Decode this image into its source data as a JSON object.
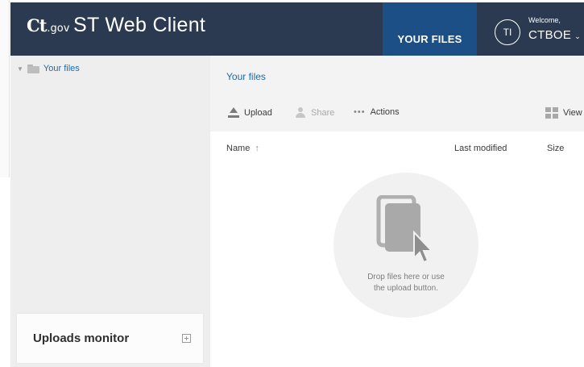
{
  "header": {
    "logo_ct": "Ct",
    "logo_gov": ".gov",
    "app_title": "ST Web Client",
    "nav_tab": "YOUR FILES",
    "avatar_initials": "TI",
    "welcome": "Welcome,",
    "user_name": "CTBOE",
    "user_caret": "⌄",
    "bg_color": "#2b3a50",
    "active_tab_color": "#1b4f86"
  },
  "sidebar": {
    "tree_item": "Your files",
    "tree_arrow": "▼",
    "uploads_monitor": "Uploads monitor"
  },
  "main": {
    "breadcrumb": "Your files",
    "toolbar": {
      "upload": "Upload",
      "share": "Share",
      "actions_dots": "•••",
      "actions": "Actions",
      "view": "View"
    },
    "columns": {
      "name": "Name",
      "name_sort": "↑",
      "last_modified": "Last modified",
      "size": "Size"
    },
    "drop_zone": {
      "line1": "Drop files here or use",
      "line2": "the upload button."
    },
    "link_color": "#1c6aa8"
  },
  "icons": [
    "folder-icon",
    "upload-icon",
    "share-icon",
    "more-dots-icon",
    "view-grid-icon",
    "sort-up-icon",
    "expand-icon",
    "files-cursor-icon",
    "chevron-down-icon"
  ]
}
